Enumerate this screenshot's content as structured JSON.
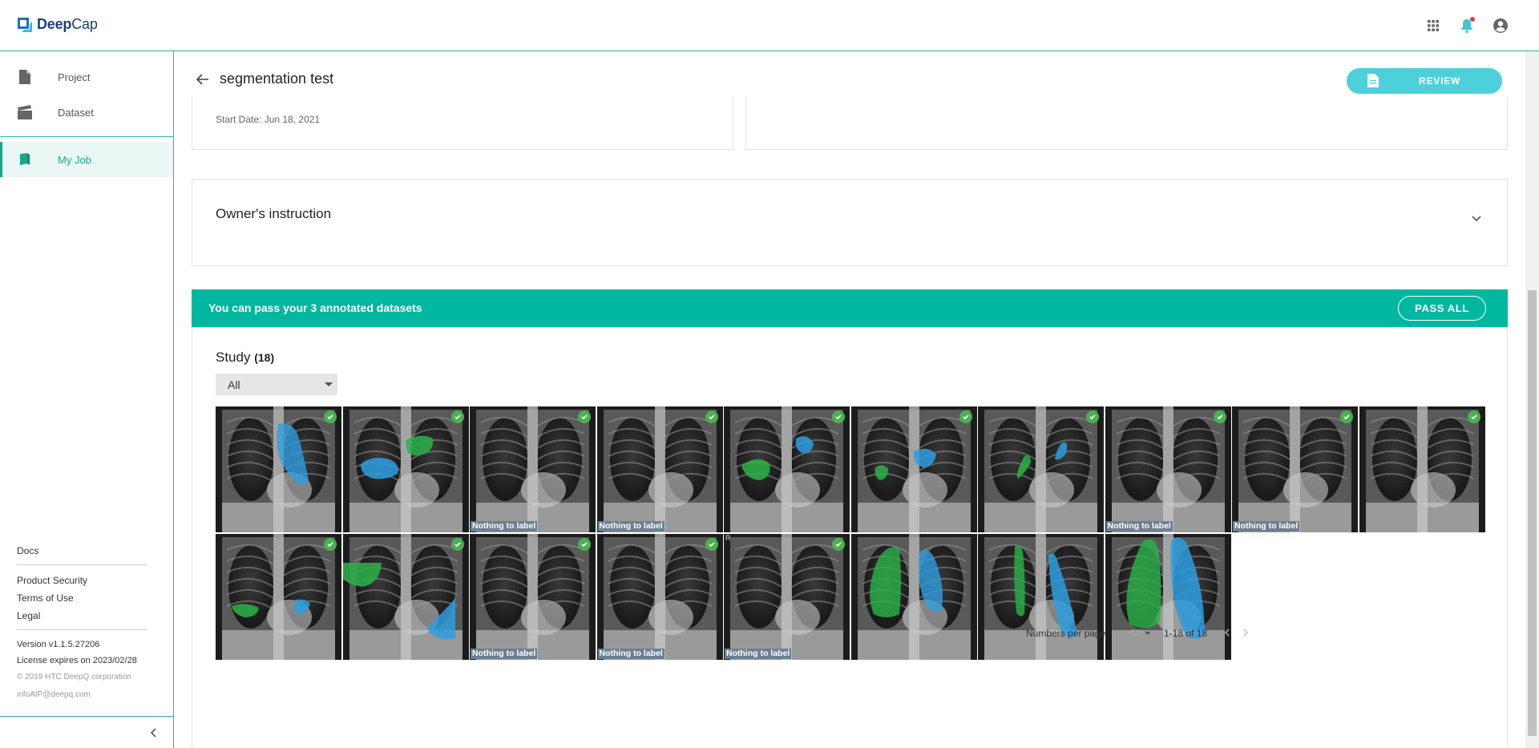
{
  "app": {
    "logo_bold": "Deep",
    "logo_light": "Cap"
  },
  "topbar": {
    "icons": [
      "apps-grid-icon",
      "bell-icon",
      "account-circle-icon"
    ],
    "notification_dot_color": "#e53935"
  },
  "sidebar": {
    "items": [
      {
        "label": "Project",
        "icon": "file-icon"
      },
      {
        "label": "Dataset",
        "icon": "clapperboard-icon"
      },
      {
        "label": "My Job",
        "icon": "book-icon",
        "active": true
      }
    ],
    "footer": {
      "docs": "Docs",
      "product_security": "Product Security",
      "terms": "Terms of Use",
      "legal": "Legal",
      "version": "Version v1.1.5.27206",
      "license": "License expires on 2023/02/28",
      "copyright": "© 2019 HTC DeepQ corporation",
      "email": "infoAIP@deepq.com"
    }
  },
  "header": {
    "title": "segmentation test",
    "review_label": "REVIEW"
  },
  "info": {
    "start_date": "Start Date: Jun 18, 2021"
  },
  "instruction": {
    "title": "Owner's instruction"
  },
  "pass": {
    "message": "You can pass your 3 annotated datasets",
    "button": "PASS ALL"
  },
  "study": {
    "title": "Study",
    "count": "(18)",
    "filter_value": "All",
    "nothing_label": "Nothing to label",
    "thumbnails": [
      {
        "checked": true,
        "nothing": false
      },
      {
        "checked": true,
        "nothing": false
      },
      {
        "checked": true,
        "nothing": true
      },
      {
        "checked": true,
        "nothing": true
      },
      {
        "checked": true,
        "nothing": false
      },
      {
        "checked": true,
        "nothing": false
      },
      {
        "checked": true,
        "nothing": false
      },
      {
        "checked": true,
        "nothing": true
      },
      {
        "checked": true,
        "nothing": true
      },
      {
        "checked": true,
        "nothing": false
      },
      {
        "checked": true,
        "nothing": false
      },
      {
        "checked": true,
        "nothing": false
      },
      {
        "checked": true,
        "nothing": true
      },
      {
        "checked": true,
        "nothing": true
      },
      {
        "checked": true,
        "nothing": true,
        "corner_tag": "R"
      },
      {
        "checked": false,
        "nothing": false
      },
      {
        "checked": false,
        "nothing": false
      },
      {
        "checked": false,
        "nothing": false
      }
    ]
  },
  "pager": {
    "label": "Numbers per page:",
    "per_page": "50",
    "range": "1-18 of 18"
  },
  "colors": {
    "accent": "#00b89f",
    "review": "#4dd0da",
    "mask_blue": "#2f9ee0",
    "mask_green": "#2bb34a",
    "check": "#4caf50"
  }
}
